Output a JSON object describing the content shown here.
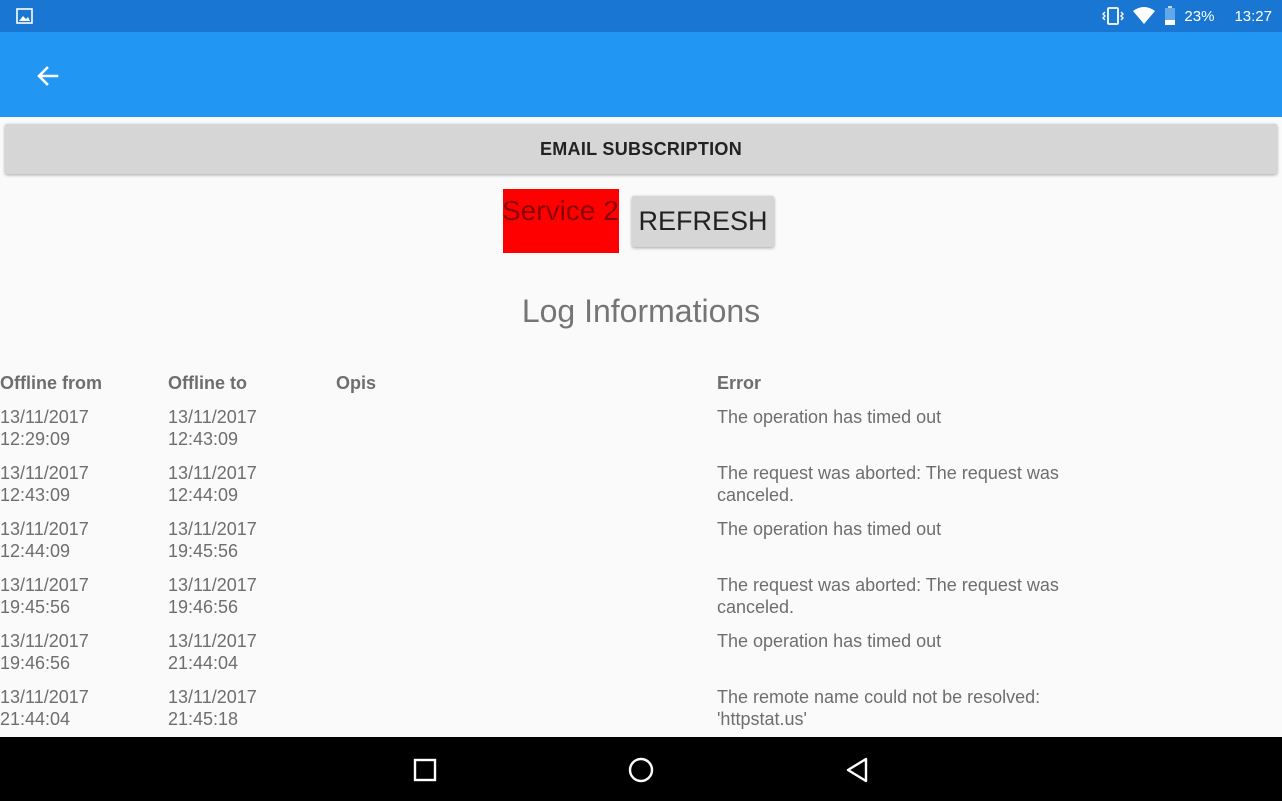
{
  "status_bar": {
    "battery_percent": "23%",
    "time": "13:27",
    "icons": [
      "image-icon",
      "vibrate-icon",
      "wifi-icon",
      "battery-icon"
    ]
  },
  "app_bar": {
    "back_icon": "arrow-back-icon",
    "color": "#2196f3"
  },
  "email_subscription_label": "EMAIL SUBSCRIPTION",
  "service": {
    "label": "Service 2",
    "status_color": "#ff0000"
  },
  "refresh_label": "REFRESH",
  "log": {
    "title": "Log Informations",
    "columns": [
      "Offline from",
      "Offline to",
      "Opis",
      "Error"
    ],
    "rows": [
      {
        "from_date": "13/11/2017",
        "from_time": "12:29:09",
        "to_date": "13/11/2017",
        "to_time": "12:43:09",
        "opis": "",
        "error_line1": "The operation has timed out",
        "error_line2": ""
      },
      {
        "from_date": "13/11/2017",
        "from_time": "12:43:09",
        "to_date": "13/11/2017",
        "to_time": "12:44:09",
        "opis": "",
        "error_line1": "The request was aborted: The request was",
        "error_line2": "canceled."
      },
      {
        "from_date": "13/11/2017",
        "from_time": "12:44:09",
        "to_date": "13/11/2017",
        "to_time": "19:45:56",
        "opis": "",
        "error_line1": "The operation has timed out",
        "error_line2": ""
      },
      {
        "from_date": "13/11/2017",
        "from_time": "19:45:56",
        "to_date": "13/11/2017",
        "to_time": "19:46:56",
        "opis": "",
        "error_line1": "The request was aborted: The request was",
        "error_line2": "canceled."
      },
      {
        "from_date": "13/11/2017",
        "from_time": "19:46:56",
        "to_date": "13/11/2017",
        "to_time": "21:44:04",
        "opis": "",
        "error_line1": "The operation has timed out",
        "error_line2": ""
      },
      {
        "from_date": "13/11/2017",
        "from_time": "21:44:04",
        "to_date": "13/11/2017",
        "to_time": "21:45:18",
        "opis": "",
        "error_line1": "The remote name could not be resolved:",
        "error_line2": "'httpstat.us'"
      }
    ]
  },
  "nav_bar": {
    "icons": [
      "recent-apps-icon",
      "home-icon",
      "back-triangle-icon"
    ]
  }
}
